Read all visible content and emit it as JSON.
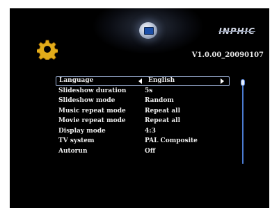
{
  "header": {
    "brand": "INPHIC",
    "version": "V1.0.00_20090107",
    "settings_icon": "gear-icon",
    "device_icon": "tv-device-icon"
  },
  "menu": {
    "items": [
      {
        "label": "Language",
        "value": "English"
      },
      {
        "label": "Slideshow duration",
        "value": "5s"
      },
      {
        "label": "Slideshow mode",
        "value": "Random"
      },
      {
        "label": "Music repeat mode",
        "value": "Repeat all"
      },
      {
        "label": "Movie repeat mode",
        "value": "Repeat all"
      },
      {
        "label": "Display  mode",
        "value": "4:3"
      },
      {
        "label": "TV system",
        "value": "PAL Composite"
      },
      {
        "label": "Autorun",
        "value": "Off"
      }
    ],
    "selected_index": 0
  },
  "colors": {
    "background": "#000000",
    "gear": "#e2ac1a",
    "selection_border": "#9fb3d9",
    "scrollbar": "#4b7bd1"
  }
}
